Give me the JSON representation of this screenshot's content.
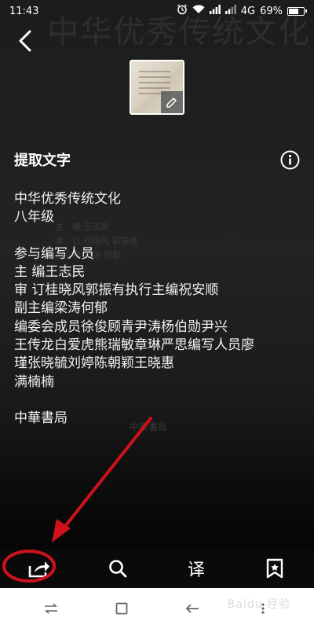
{
  "status_bar": {
    "time": "11:43",
    "network": "4G",
    "battery_text": "69%",
    "battery_level": 0.69
  },
  "background": {
    "photo_title": "中华优秀传统文化",
    "photo_lines": [
      "主　编 王志民",
      "审　订 桂晓风 郭振有",
      "副主编 梁涛 何郁"
    ],
    "photo_stamp": "中華書局"
  },
  "header": {
    "back_icon": "chevron-left-icon",
    "thumbnail_icon": "edit-icon"
  },
  "section": {
    "title": "提取文字",
    "info_icon": "info-circle-icon"
  },
  "extracted_text": {
    "lines": [
      "中华优秀传统文化",
      "八年级",
      "",
      "参与编写人员",
      "主  编王志民",
      "审  订桂晓风郭振有执行主编祝安顺",
      "副主编梁涛何郁",
      "编委会成员徐俊顾青尹涛杨伯勋尹兴",
      "王传龙白爱虎熊瑞敏章琳严思编写人员廖",
      "瑾张晓毓刘婷陈朝颖王晓惠",
      "满楠楠",
      "",
      "中華書局"
    ]
  },
  "toolbar": {
    "share_icon": "share-icon",
    "search_icon": "search-icon",
    "translate_label": "译",
    "bookmark_icon": "bookmark-icon"
  },
  "nav_bar": {
    "icons": [
      "switch-icon",
      "square-icon",
      "back-arrow-icon",
      "menu-icon"
    ]
  },
  "annotation": {
    "color": "#d0111b"
  },
  "watermark": "Baidu 经验"
}
